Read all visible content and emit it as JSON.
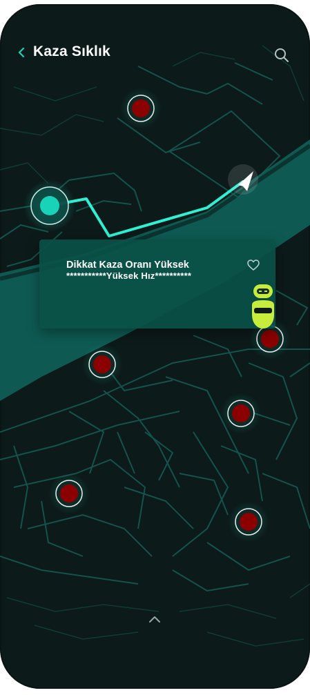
{
  "header": {
    "title": "Kaza Sıklık",
    "back_icon": "chevron-left-icon",
    "search_icon": "search-icon"
  },
  "card": {
    "line1": "Dikkat Kaza Oranı Yüksek",
    "line2": "***********Yüksek Hız**********",
    "favorite_icon": "heart-icon"
  },
  "bottom": {
    "expand_icon": "chevron-up-icon"
  },
  "colors": {
    "background": "#0c1a19",
    "accent": "#19d3b8",
    "route": "#2ef0d2",
    "marker": "#8b0000",
    "card": "#0a5048",
    "robot": "#c8ec3c"
  }
}
